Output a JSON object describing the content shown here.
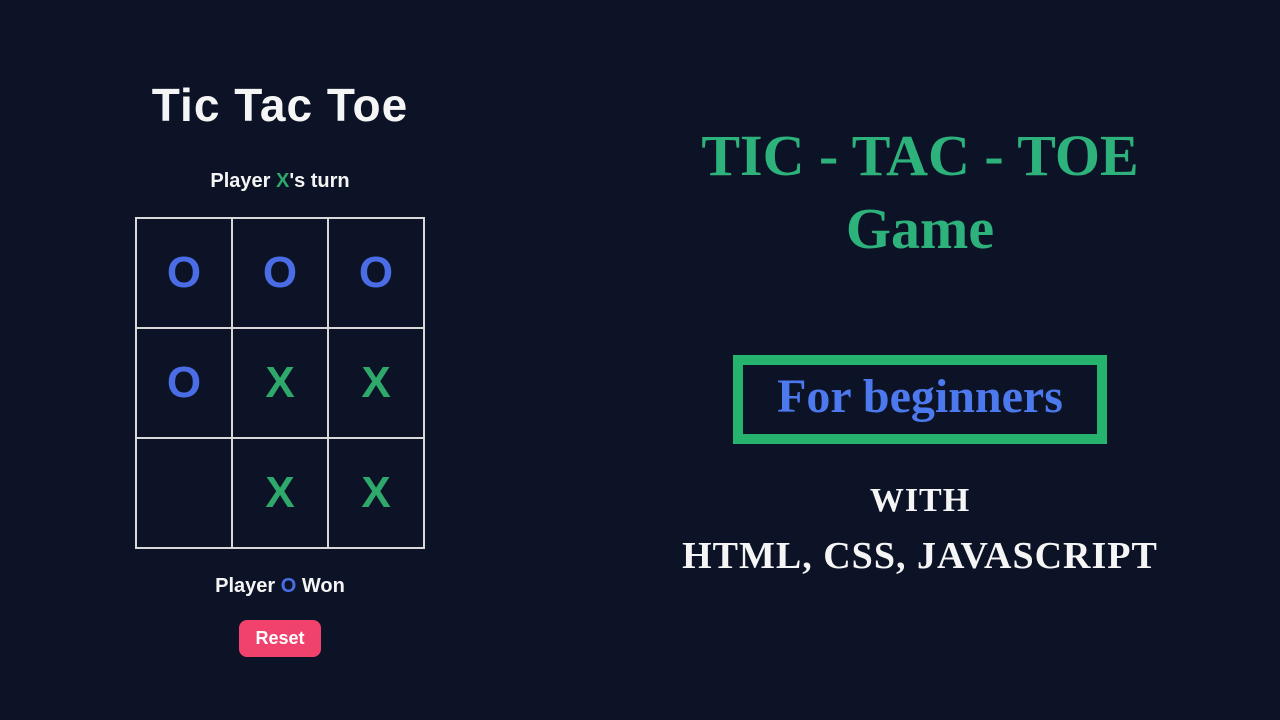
{
  "game": {
    "title": "Tic Tac Toe",
    "turn_prefix": "Player ",
    "turn_player": "X",
    "turn_suffix": "'s turn",
    "board": [
      "O",
      "O",
      "O",
      "O",
      "X",
      "X",
      "",
      "X",
      "X"
    ],
    "result_prefix": "Player ",
    "result_player": "O",
    "result_suffix": " Won",
    "reset_label": "Reset"
  },
  "promo": {
    "headline_line1": "TIC - TAC - TOE",
    "headline_line2": "Game",
    "badge_text": "For beginners",
    "with_label": "WITH",
    "tech_line": "HTML, CSS, JAVASCRIPT"
  },
  "colors": {
    "accent_green": "#2eb27b",
    "accent_blue": "#4d79ee",
    "reset_bg": "#f0426c",
    "bg": "#0d1326"
  }
}
